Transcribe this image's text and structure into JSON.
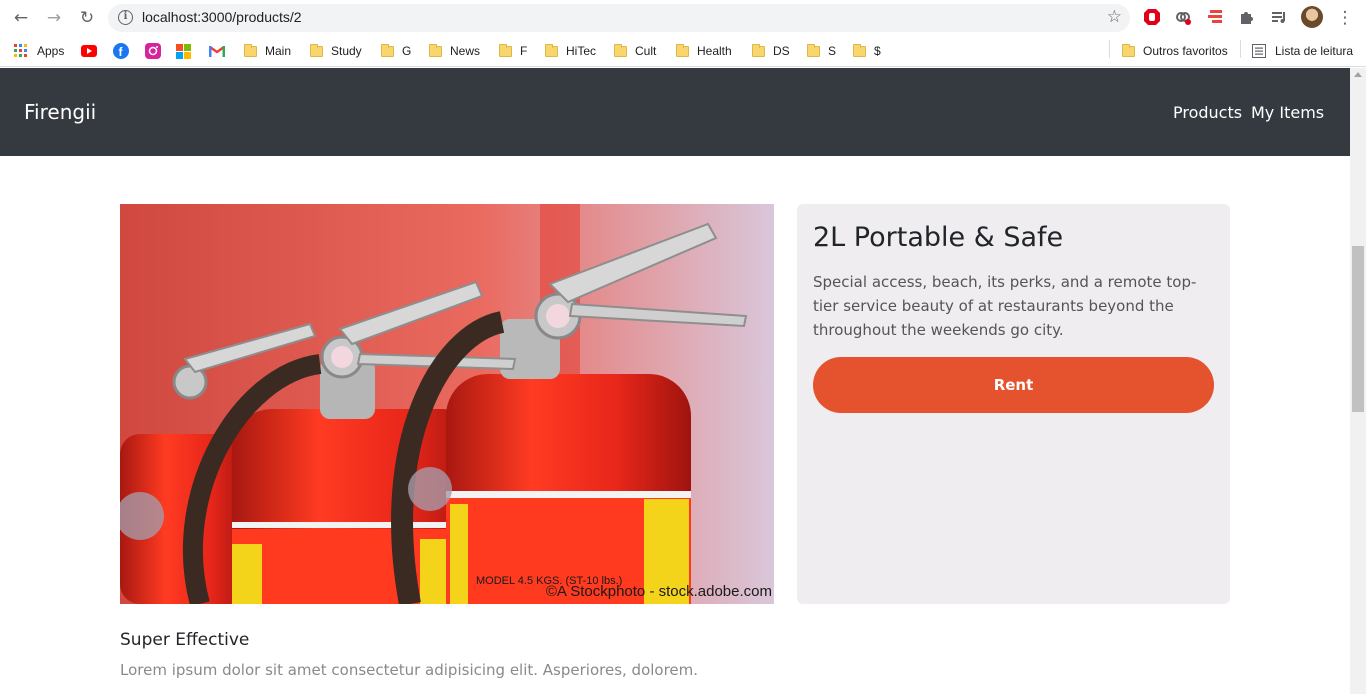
{
  "browser": {
    "url": "localhost:3000/products/2",
    "bookmarks": [
      "Apps",
      "Main",
      "Study",
      "G",
      "News",
      "F",
      "HiTec",
      "Cult",
      "Health",
      "DS",
      "S",
      "$"
    ],
    "other_bookmarks": "Outros favoritos",
    "reading_list": "Lista de leitura"
  },
  "navbar": {
    "brand": "Firengii",
    "links": [
      "Products",
      "My Items"
    ]
  },
  "product": {
    "image_watermark": "©A Stockphoto - stock.adobe.com",
    "title": "2L Portable & Safe",
    "description": "Special access, beach, its perks, and a remote top-tier service beauty of at restaurants beyond the throughout the weekends go city.",
    "button_label": "Rent"
  },
  "feature": {
    "title": "Super Effective",
    "description": "Lorem ipsum dolor sit amet consectetur adipisicing elit. Asperiores, dolorem."
  },
  "colors": {
    "navbar_bg": "#343a40",
    "card_bg": "#efedef",
    "accent": "#e4522e"
  }
}
